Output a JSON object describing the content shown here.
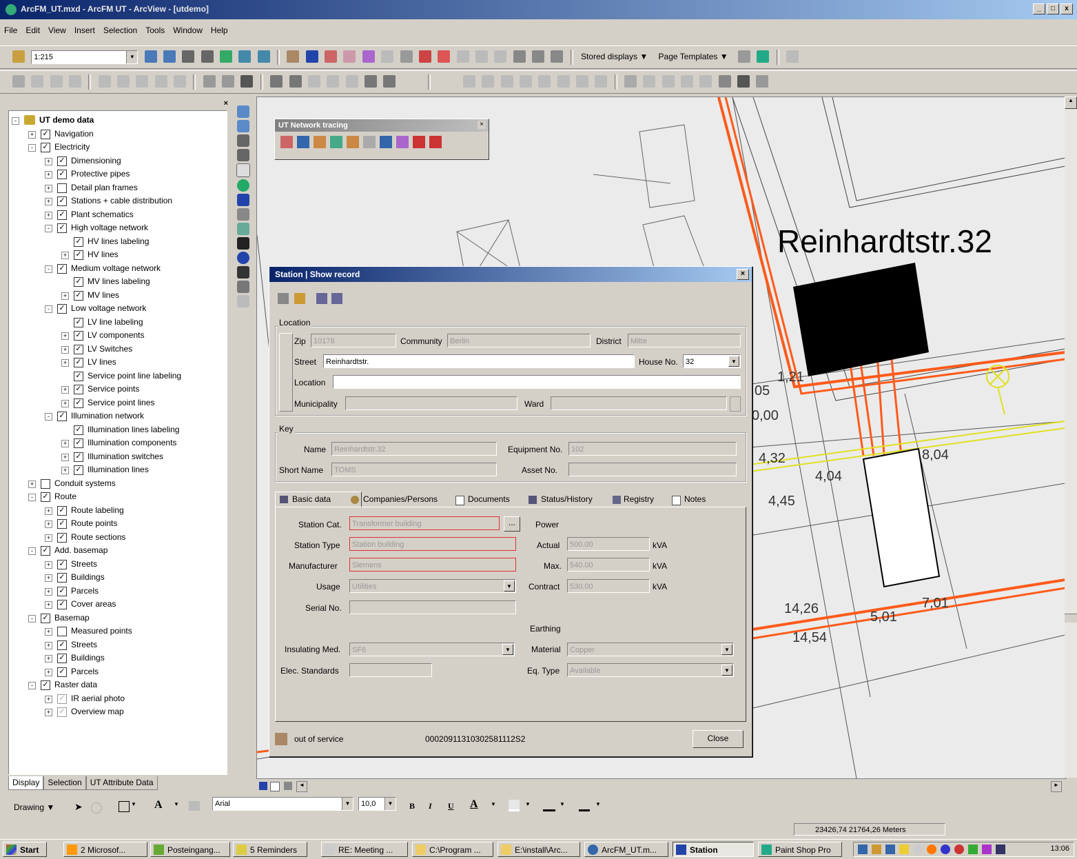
{
  "window": {
    "title": "ArcFM_UT.mxd - ArcFM UT - ArcView - [utdemo]",
    "min": "_",
    "max": "□",
    "close": "x"
  },
  "menu": [
    "File",
    "Edit",
    "View",
    "Insert",
    "Selection",
    "Tools",
    "Window",
    "Help"
  ],
  "toolbar": {
    "scale": "1:215",
    "stored_displays": "Stored displays",
    "page_templates": "Page Templates"
  },
  "toc": {
    "tabs": [
      "Display",
      "Selection",
      "UT Attribute Data"
    ],
    "items": [
      {
        "label": "UT demo data",
        "level": 0,
        "exp": "-",
        "checked": null,
        "bold": true
      },
      {
        "label": "Navigation",
        "level": 1,
        "exp": "+",
        "checked": true
      },
      {
        "label": "Electricity",
        "level": 1,
        "exp": "-",
        "checked": true
      },
      {
        "label": "Dimensioning",
        "level": 2,
        "exp": "+",
        "checked": true
      },
      {
        "label": "Protective pipes",
        "level": 2,
        "exp": "+",
        "checked": true
      },
      {
        "label": "Detail plan frames",
        "level": 2,
        "exp": "+",
        "checked": false
      },
      {
        "label": "Stations + cable distribution",
        "level": 2,
        "exp": "+",
        "checked": true
      },
      {
        "label": "Plant schematics",
        "level": 2,
        "exp": "+",
        "checked": true
      },
      {
        "label": "High voltage network",
        "level": 2,
        "exp": "-",
        "checked": true
      },
      {
        "label": "HV lines labeling",
        "level": 3,
        "exp": "",
        "checked": true
      },
      {
        "label": "HV lines",
        "level": 3,
        "exp": "+",
        "checked": true
      },
      {
        "label": "Medium voltage network",
        "level": 2,
        "exp": "-",
        "checked": true
      },
      {
        "label": "MV lines labeling",
        "level": 3,
        "exp": "",
        "checked": true
      },
      {
        "label": "MV lines",
        "level": 3,
        "exp": "+",
        "checked": true
      },
      {
        "label": "Low voltage network",
        "level": 2,
        "exp": "-",
        "checked": true
      },
      {
        "label": "LV line labeling",
        "level": 3,
        "exp": "",
        "checked": true
      },
      {
        "label": "LV components",
        "level": 3,
        "exp": "+",
        "checked": true
      },
      {
        "label": "LV Switches",
        "level": 3,
        "exp": "+",
        "checked": true
      },
      {
        "label": "LV lines",
        "level": 3,
        "exp": "+",
        "checked": true
      },
      {
        "label": "Service point line labeling",
        "level": 3,
        "exp": "",
        "checked": true
      },
      {
        "label": "Service points",
        "level": 3,
        "exp": "+",
        "checked": true
      },
      {
        "label": "Service point lines",
        "level": 3,
        "exp": "+",
        "checked": true
      },
      {
        "label": "Illumination network",
        "level": 2,
        "exp": "-",
        "checked": true
      },
      {
        "label": "Illumination lines labeling",
        "level": 3,
        "exp": "",
        "checked": true
      },
      {
        "label": "Illumination components",
        "level": 3,
        "exp": "+",
        "checked": true
      },
      {
        "label": "Illumination switches",
        "level": 3,
        "exp": "+",
        "checked": true
      },
      {
        "label": "Illumination lines",
        "level": 3,
        "exp": "+",
        "checked": true
      },
      {
        "label": "Conduit systems",
        "level": 1,
        "exp": "+",
        "checked": false
      },
      {
        "label": "Route",
        "level": 1,
        "exp": "-",
        "checked": true
      },
      {
        "label": "Route labeling",
        "level": 2,
        "exp": "+",
        "checked": true
      },
      {
        "label": "Route points",
        "level": 2,
        "exp": "+",
        "checked": true
      },
      {
        "label": "Route sections",
        "level": 2,
        "exp": "+",
        "checked": true
      },
      {
        "label": "Add. basemap",
        "level": 1,
        "exp": "-",
        "checked": true
      },
      {
        "label": "Streets",
        "level": 2,
        "exp": "+",
        "checked": true
      },
      {
        "label": "Buildings",
        "level": 2,
        "exp": "+",
        "checked": true
      },
      {
        "label": "Parcels",
        "level": 2,
        "exp": "+",
        "checked": true
      },
      {
        "label": "Cover areas",
        "level": 2,
        "exp": "+",
        "checked": true
      },
      {
        "label": "Basemap",
        "level": 1,
        "exp": "-",
        "checked": true
      },
      {
        "label": "Measured points",
        "level": 2,
        "exp": "+",
        "checked": false
      },
      {
        "label": "Streets",
        "level": 2,
        "exp": "+",
        "checked": true
      },
      {
        "label": "Buildings",
        "level": 2,
        "exp": "+",
        "checked": true
      },
      {
        "label": "Parcels",
        "level": 2,
        "exp": "+",
        "checked": true
      },
      {
        "label": "Raster data",
        "level": 1,
        "exp": "-",
        "checked": true
      },
      {
        "label": "IR aerial photo",
        "level": 2,
        "exp": "+",
        "checked": "gray"
      },
      {
        "label": "Overview map",
        "level": 2,
        "exp": "+",
        "checked": "gray"
      }
    ]
  },
  "utnet": {
    "title": "UT Network tracing"
  },
  "map": {
    "address": "Reinhardtstr.32",
    "dims": [
      "1,21",
      "05",
      "0,00",
      "4,32",
      "4,04",
      "4,45",
      "8,04",
      "14,26",
      "5,01",
      "7,01",
      "14,54"
    ]
  },
  "dialog": {
    "title": "Station | Show record",
    "location": {
      "group": "Location",
      "zip_l": "Zip",
      "zip": "10178",
      "community_l": "Community",
      "community": "Berlin",
      "district_l": "District",
      "district": "Mitte",
      "street_l": "Street",
      "street": "Reinhardtstr.",
      "houseno_l": "House No.",
      "houseno": "32",
      "location_l": "Location",
      "location": "",
      "municipality_l": "Municipality",
      "municipality": "",
      "ward_l": "Ward",
      "ward": ""
    },
    "key": {
      "group": "Key",
      "name_l": "Name",
      "name": "Reinhardtstr.32",
      "equip_l": "Equipment No.",
      "equip": "102",
      "short_l": "Short Name",
      "short": "TOMS",
      "asset_l": "Asset No.",
      "asset": ""
    },
    "tabs": [
      "Basic data",
      "Companies/Persons",
      "Documents",
      "Status/History",
      "Registry",
      "Notes"
    ],
    "basic": {
      "cat_l": "Station Cat.",
      "cat": "Transformer building",
      "type_l": "Station Type",
      "type": "Station building",
      "manuf_l": "Manufacturer",
      "manuf": "Siemens",
      "usage_l": "Usage",
      "usage": "Utilities",
      "serial_l": "Serial No.",
      "serial": "",
      "insul_l": "Insulating Med.",
      "insul": "SF6",
      "elec_l": "Elec. Standards",
      "elec": ""
    },
    "power": {
      "title": "Power",
      "actual_l": "Actual",
      "actual": "500.00",
      "max_l": "Max.",
      "max": "540.00",
      "contract_l": "Contract",
      "contract": "530.00",
      "unit": "kVA"
    },
    "earthing": {
      "title": "Earthing",
      "material_l": "Material",
      "material": "Copper",
      "eqtype_l": "Eq. Type",
      "eqtype": "Available"
    },
    "status": "out of service",
    "record_id": "00020911310302581112S2",
    "close": "Close"
  },
  "drawing": {
    "label": "Drawing",
    "font": "Arial",
    "size": "10,0",
    "bold": "B",
    "italic": "I",
    "underline": "U",
    "text_a": "A"
  },
  "statusbar": {
    "coords": "23426,74  21764,26 Meters"
  },
  "taskbar": {
    "start": "Start",
    "items": [
      "2 Microsof...",
      "Posteingang...",
      "5 Reminders",
      "RE: Meeting ...",
      "C:\\Program ...",
      "E:\\install\\Arc...",
      "ArcFM_UT.m...",
      "Station",
      "Paint Shop Pro"
    ],
    "clock": "13:06"
  }
}
